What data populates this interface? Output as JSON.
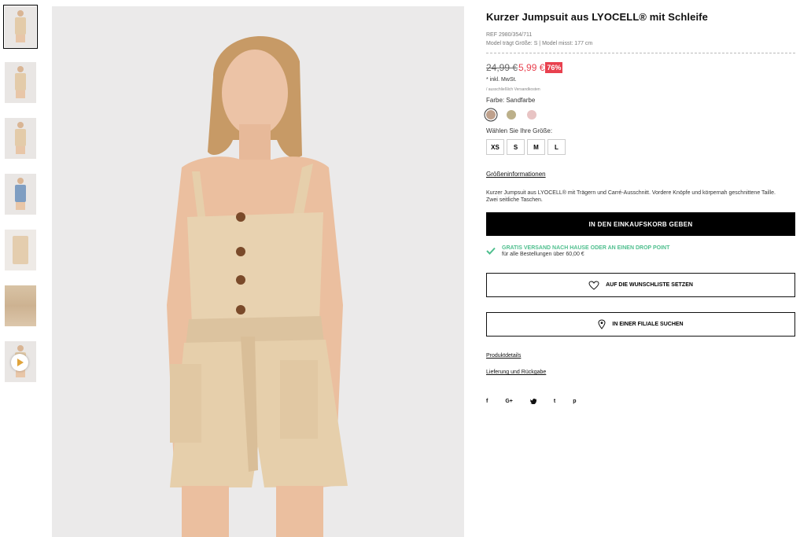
{
  "product": {
    "title": "Kurzer Jumpsuit aus LYOCELL® mit Schleife",
    "ref": "REF 2980/354/711",
    "model_info": "Model trägt Größe: S | Model misst: 177 cm",
    "old_price": "24,99 €",
    "new_price": "5,99 €",
    "discount": "76%",
    "tax_note": "* inkl. MwSt.",
    "shipping_note": "/ ausschließlich Versandkosten",
    "color_label": "Farbe: Sandfarbe",
    "colors": [
      {
        "name": "Sandfarbe",
        "hex": "#bfa18c",
        "selected": true
      },
      {
        "name": "khaki",
        "hex": "#bcb08a",
        "selected": false
      },
      {
        "name": "rosa",
        "hex": "#e8c4c4",
        "selected": false
      }
    ],
    "size_label": "Wählen Sie Ihre Größe:",
    "sizes": [
      "XS",
      "S",
      "M",
      "L"
    ],
    "size_info_link": "Größeninformationen",
    "description": "Kurzer Jumpsuit aus LYOCELL® mit Trägern und Carré-Ausschnitt. Vordere Knöpfe und körpernah geschnittene Taille. Zwei seitliche Taschen.",
    "add_to_cart": "IN DEN EINKAUFSKORB GEBEN",
    "free_shipping_title": "GRATIS VERSAND NACH HAUSE ODER AN EINEN DROP POINT",
    "free_shipping_sub": "für alle Bestellungen über 60,00 €",
    "wishlist_button": "AUF DIE WUNSCHLISTE SETZEN",
    "store_button": "IN EINER FILIALE SUCHEN",
    "product_details_link": "Produktdetails",
    "delivery_link": "Lieferung und Rückgabe"
  },
  "social": [
    {
      "icon": "facebook-icon",
      "glyph": "f"
    },
    {
      "icon": "google-plus-icon",
      "glyph": "G+"
    },
    {
      "icon": "twitter-icon",
      "glyph": "🐦"
    },
    {
      "icon": "tumblr-icon",
      "glyph": "t"
    },
    {
      "icon": "pinterest-icon",
      "glyph": "p"
    }
  ],
  "colors": {
    "accent_red": "#e8404e",
    "free_shipping_green": "#4fbf8e",
    "cart_bg": "#000000"
  }
}
